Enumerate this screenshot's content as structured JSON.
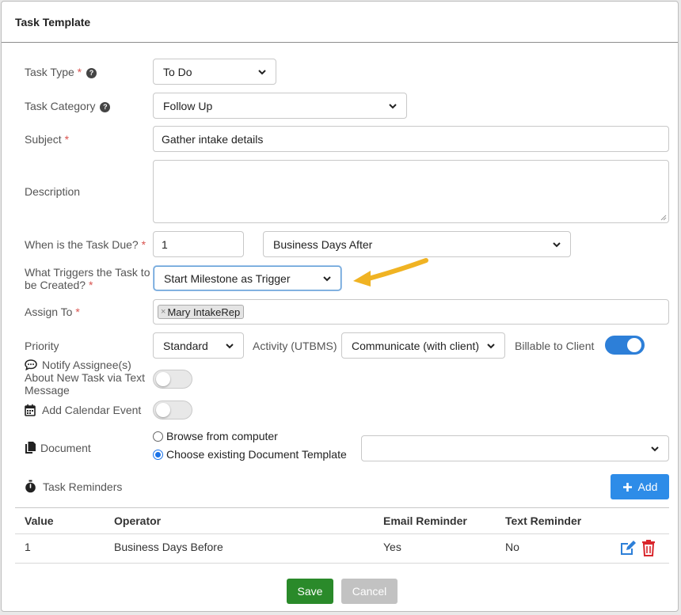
{
  "modal": {
    "title": "Task Template"
  },
  "required_mark": "*",
  "help_mark": "?",
  "form": {
    "task_type": {
      "label": "Task Type",
      "value": "To Do"
    },
    "task_category": {
      "label": "Task Category",
      "value": "Follow Up"
    },
    "subject": {
      "label": "Subject",
      "value": "Gather intake details"
    },
    "description": {
      "label": "Description",
      "value": ""
    },
    "due": {
      "label": "When is the Task Due?",
      "amount": "1",
      "unit": "Business Days After"
    },
    "trigger": {
      "label_line1": "What Triggers the Task to",
      "label_line2": "be Created?",
      "value": "Start Milestone as Trigger"
    },
    "assign_to": {
      "label": "Assign To",
      "remove_mark": "×",
      "assignee": "Mary IntakeRep"
    },
    "priority": {
      "label": "Priority",
      "value": "Standard"
    },
    "activity": {
      "label": "Activity (UTBMS)",
      "value": "Communicate (with client)"
    },
    "billable": {
      "label": "Billable to Client",
      "on": true
    },
    "notify": {
      "label_line1": "Notify Assignee(s)",
      "label_line2": "About New Task via Text",
      "label_line3": "Message",
      "on": false
    },
    "calendar": {
      "label": "Add Calendar Event",
      "on": false
    },
    "document": {
      "label": "Document",
      "option_browse": "Browse from computer",
      "option_existing": "Choose existing Document Template",
      "selected": "existing",
      "template_value": ""
    }
  },
  "reminders": {
    "title": "Task Reminders",
    "add_label": "Add",
    "columns": [
      "Value",
      "Operator",
      "Email Reminder",
      "Text Reminder"
    ],
    "rows": [
      {
        "value": "1",
        "operator": "Business Days Before",
        "email": "Yes",
        "text": "No"
      }
    ]
  },
  "footer": {
    "save_label": "Save",
    "cancel_label": "Cancel"
  },
  "colors": {
    "accent": "#2d7fd8",
    "save": "#2a8a2a",
    "delete": "#d9262c",
    "arrow": "#f0b323"
  },
  "icons": [
    "help-icon",
    "chevron-down-icon",
    "comment-icon",
    "calendar-icon",
    "document-icon",
    "stopwatch-icon",
    "plus-icon",
    "edit-icon",
    "trash-icon",
    "arrow-annotation-icon"
  ]
}
